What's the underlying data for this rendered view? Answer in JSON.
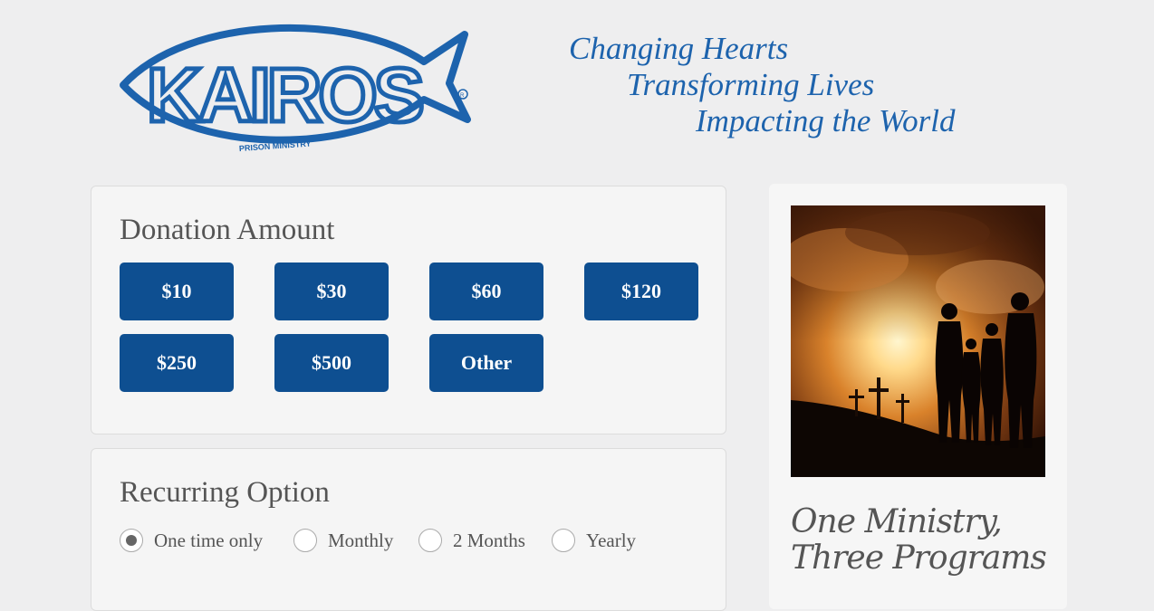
{
  "header": {
    "logo_icon": "kairos-ichthys-logo",
    "logo_text": "KAIROS",
    "logo_subtext": "PRISON MINISTRY",
    "tagline": [
      "Changing Hearts",
      "Transforming Lives",
      "Impacting the World"
    ]
  },
  "donation": {
    "title": "Donation Amount",
    "amounts": [
      "$10",
      "$30",
      "$60",
      "$120",
      "$250",
      "$500",
      "Other"
    ]
  },
  "recurring": {
    "title": "Recurring Option",
    "options": [
      "One time only",
      "Monthly",
      "2 Months",
      "Yearly"
    ],
    "selected": "One time only"
  },
  "sidebar": {
    "image_icon": "family-silhouette-crosses-sunset-image",
    "heading_line1": "One Ministry,",
    "heading_line2": "Three Programs"
  },
  "colors": {
    "brand_blue": "#0e4f91",
    "logo_blue": "#1d63ad",
    "background": "#eeeeef",
    "card_bg": "#f5f5f5"
  }
}
